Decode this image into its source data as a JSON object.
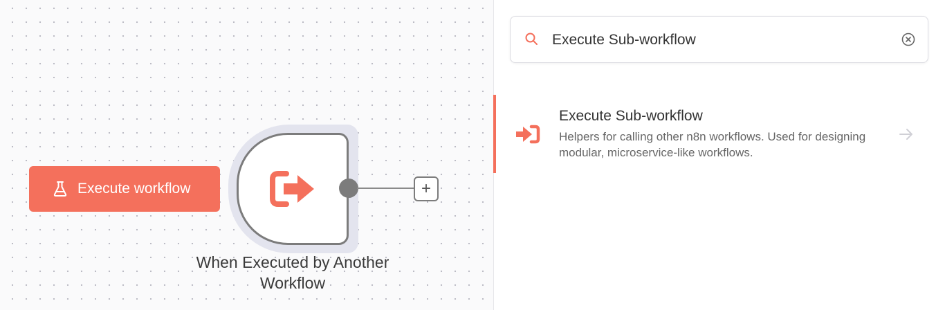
{
  "canvas": {
    "execute_button_label": "Execute workflow",
    "node": {
      "label": "When Executed by Another Workflow",
      "icon": "sign-out-icon",
      "add_symbol": "+"
    }
  },
  "panel": {
    "search": {
      "value": "Execute Sub-workflow",
      "icon": "search-icon",
      "clear_icon": "clear-circle-icon"
    },
    "results": [
      {
        "title": "Execute Sub-workflow",
        "description": "Helpers for calling other n8n workflows. Used for designing modular, microservice-like workflows.",
        "icon": "sign-in-icon",
        "arrow_icon": "arrow-right-icon"
      }
    ]
  },
  "colors": {
    "accent": "#f4705c",
    "node_border": "#7c7c7c",
    "node_halo": "#e3e4ee",
    "canvas_bg": "#fafafb"
  }
}
